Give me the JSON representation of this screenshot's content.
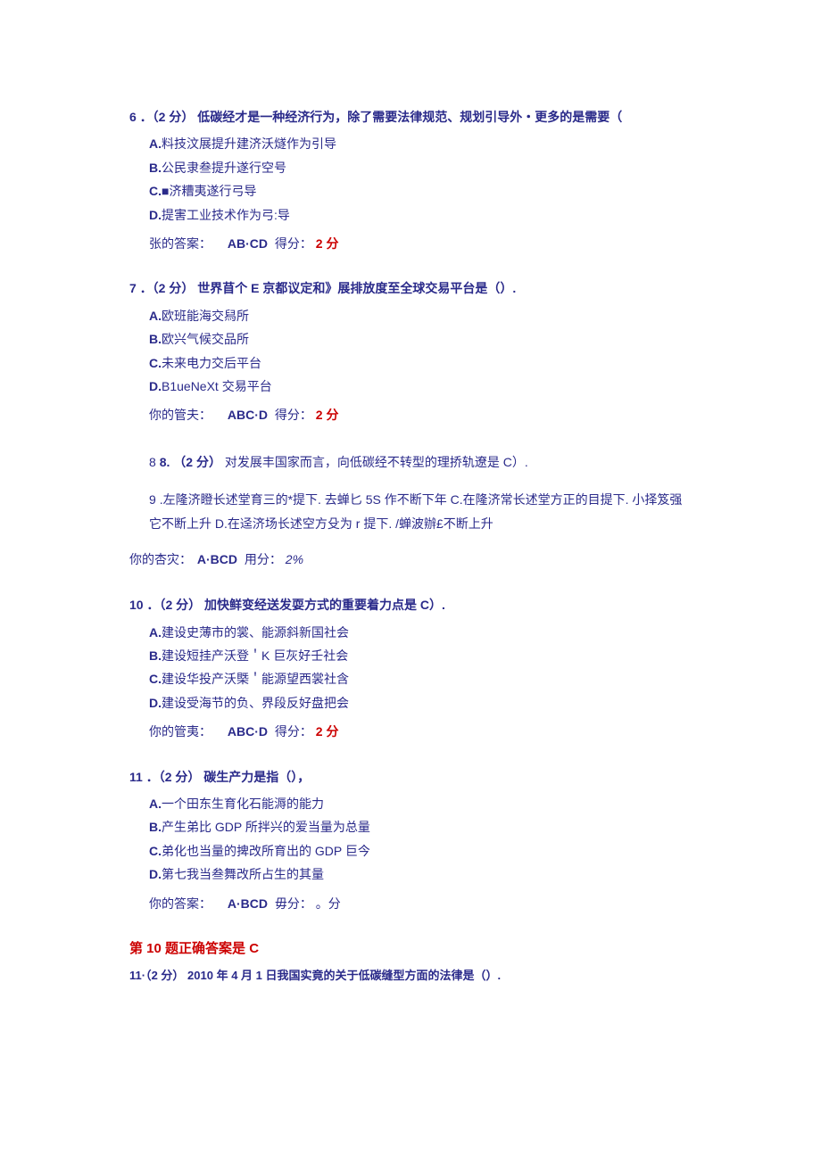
{
  "questions": [
    {
      "num": "6",
      "points": "．（2 分）",
      "text": "低碳经才是一种经济行为，除了需要法律规范、规划引导外・更多的是需要（",
      "options": [
        {
          "letter": "A.",
          "text": "料技汶展提升建济沃燧作为引导"
        },
        {
          "letter": "B.",
          "text": "公民隶叁提升遂行空号"
        },
        {
          "letter": "C.",
          "text": "■济糟夷遂行弓导"
        },
        {
          "letter": "D.",
          "text": "提害工业技术作为弓:导"
        }
      ],
      "answer_label": "张的答案：",
      "answer_value": "AB·CD",
      "score_label": " 得分：",
      "score_value": "2 分"
    },
    {
      "num": "7",
      "points": "．（2 分）",
      "text": "世界苜个 E 京都议定和》展排放度至全球交易平台是（）.",
      "options": [
        {
          "letter": "A.",
          "text": "欧班能海交舄所"
        },
        {
          "letter": "B.",
          "text": "欧兴气候交品所"
        },
        {
          "letter": "C.",
          "text": "未来电力交后平台"
        },
        {
          "letter": "D.",
          "text": "B1ueNeXt 交易平台"
        }
      ],
      "answer_label": "你的管夫：",
      "answer_value": "ABC·D",
      "score_label": " 得分：",
      "score_value": "2 分"
    }
  ],
  "q8": {
    "num": "8",
    "label": "  8.",
    "points": "（2 分）",
    "text": "对发展丰国家而言，向低碳经不转型的理挢轨遼是 C）."
  },
  "q9": {
    "num": "9",
    "text": "  .左隆济瞪长述堂育三的*提下. 去蝉匕 5S 作不断下年 C.在隆济常长述堂方正的目提下. 小择笈强它不断上升 D.在迳济场长述空方殳为 r 提下. /蝉波辦£不断上升"
  },
  "q8_answer": {
    "label": "你的杏灾：",
    "value": "A·BCD",
    "score_label": " 用分：",
    "score_value": "2%"
  },
  "q10": {
    "num": "10",
    "points": "．（2 分）",
    "text": "加快鲜变经送发耍方式的重要着力点是 C）.",
    "options": [
      {
        "letter": "A.",
        "text": "建设史薄市的裳、能源斜新国社会"
      },
      {
        "letter": "B.",
        "text": "建设短挂产沃登＇K 巨灰好壬社会"
      },
      {
        "letter": "C.",
        "text": "建设华投产沃槩＇能源望西裳社含"
      },
      {
        "letter": "D.",
        "text": "建设受海节的负、界段反好盘把会"
      }
    ],
    "answer_label": "你的管夷：",
    "answer_value": "ABC·D",
    "score_label": " 得分：",
    "score_value": "2 分"
  },
  "q11": {
    "num": "11",
    "points": "．（2 分）",
    "text": "碳生产力是指（），",
    "options": [
      {
        "letter": "A.",
        "text": "一个田东生育化石能溽的能力"
      },
      {
        "letter": "B.",
        "text": "产生弟比 GDP 所拌兴的爱当量为总量"
      },
      {
        "letter": "C.",
        "text": "弟化也当量的捭改所育出的 GDP 巨今"
      },
      {
        "letter": "D.",
        "text": "第七我当叁舞改所占生的其量"
      }
    ],
    "answer_label": "你的答案：",
    "answer_value": "A·BCD",
    "score_label": " 毋分：",
    "score_value": "。分"
  },
  "correction": "第 10 题正确答案是 C",
  "q11b": {
    "label": "11·（2 分）",
    "text": "2010 年 4 月 1 日我国实竟的关于低碳缝型方面的法律是（）."
  }
}
